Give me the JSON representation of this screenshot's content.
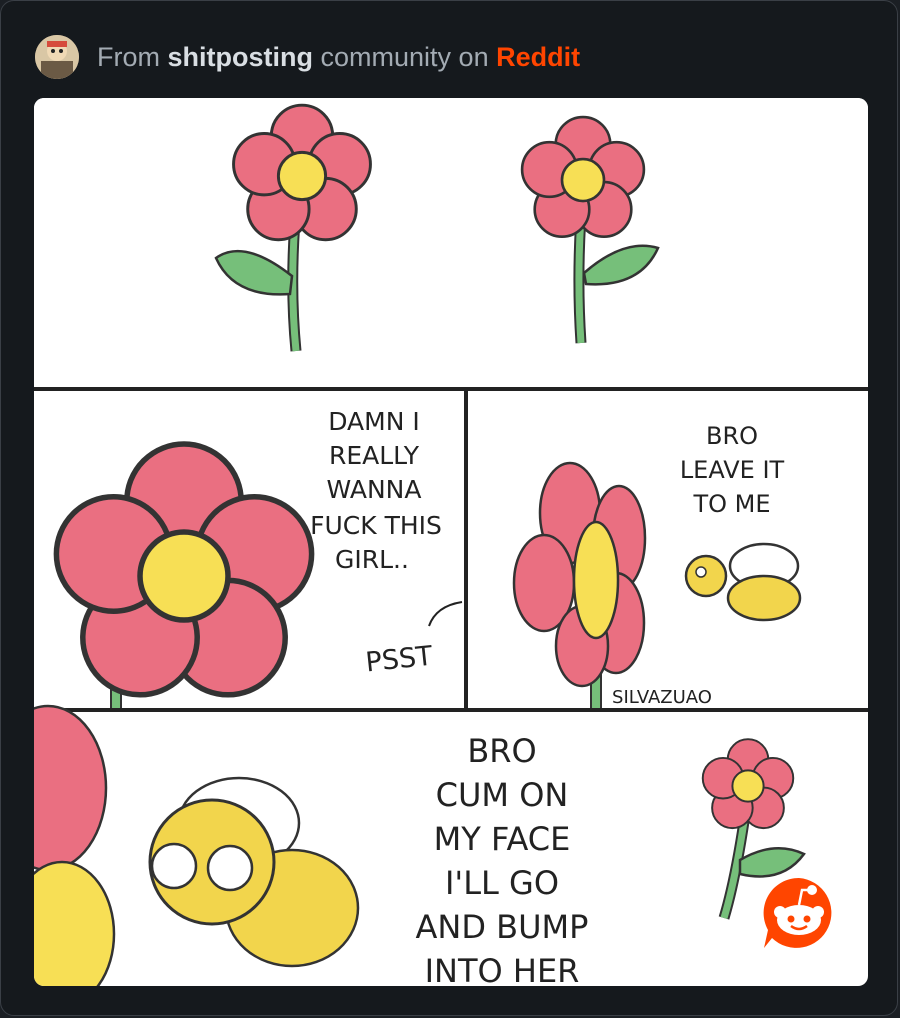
{
  "header": {
    "prefix": "From",
    "community": "shitposting",
    "middle": "community on",
    "brand": "Reddit"
  },
  "comic": {
    "panel2_speech": [
      "DAMN I",
      "REALLY",
      "WANNA",
      "FUCK THIS",
      "GIRL.."
    ],
    "panel2_whisper": "PSST",
    "panel3_speech": [
      "BRO",
      "LEAVE IT",
      "TO ME"
    ],
    "panel3_signature": "SILVAZUAO",
    "panel4_speech": [
      "BRO",
      "CUM ON",
      "MY FACE",
      "I'LL GO",
      "AND BUMP",
      "INTO HER"
    ]
  },
  "icons": {
    "avatar": "community-avatar",
    "reddit": "reddit-logo-icon"
  },
  "colors": {
    "brand": "#ff4500",
    "petal": "#ea6f81",
    "face": "#f7df55",
    "leaf": "#76bf7a",
    "bee_yellow": "#f2d54c"
  }
}
